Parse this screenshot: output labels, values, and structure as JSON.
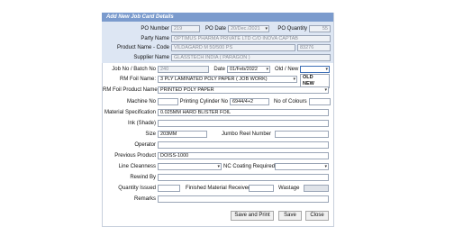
{
  "window": {
    "title": "Add New Job Card Details"
  },
  "header": {
    "po_number": {
      "label": "PO Number",
      "value": "219"
    },
    "po_date": {
      "label": "PO Date",
      "value": "20/Dec./2021"
    },
    "po_quantity": {
      "label": "PO Quantity",
      "value": "55"
    },
    "party_name": {
      "label": "Party Name",
      "value": "OPTIMUS PHARMA PRIVATE LTD C/O INOVA CAPTAB"
    },
    "product_name_code": {
      "label": "Product Name - Code",
      "value": "VILDAGARD M 50/500 PS",
      "code": "83276"
    },
    "supplier_name": {
      "label": "Supplier Name",
      "value": "GLASSTECH INDIA ( PARAGON )"
    }
  },
  "form": {
    "job_batch_no": {
      "label": "Job No / Batch No",
      "value": "240"
    },
    "date": {
      "label": "Date",
      "value": "01/Feb/2022"
    },
    "old_new": {
      "label": "Old / New",
      "value": "",
      "options": [
        "OLD",
        "NEW"
      ]
    },
    "rm_foil_name": {
      "label": "RM Foil Name:",
      "value": "3 PLY LAMINATED POLY PAPER ( JOB WORK)"
    },
    "rm_foil_product_name": {
      "label": "RM Foil Product Name:",
      "value": "PRINTED POLY PAPER"
    },
    "machine_no": {
      "label": "Machine No",
      "value": ""
    },
    "printing_cylinder_no": {
      "label": "Printing Cylinder No",
      "value": "6944/4+2"
    },
    "no_of_colours": {
      "label": "No of Colours",
      "value": ""
    },
    "material_specification": {
      "label": "Material Specification",
      "value": "0.025MM HARD BLISTER FOIL"
    },
    "ink_shade": {
      "label": "Ink (Shade)",
      "value": ""
    },
    "size": {
      "label": "Size",
      "value": "203MM"
    },
    "jumbo_reel_number": {
      "label": "Jumbo Reel Number",
      "value": ""
    },
    "operator": {
      "label": "Operator",
      "value": ""
    },
    "previous_product": {
      "label": "Previous Product",
      "value": "DOISS-1000"
    },
    "line_cleanness": {
      "label": "Line Cleanness",
      "value": ""
    },
    "nc_coating_required": {
      "label": "NC Coating Required",
      "value": ""
    },
    "rewind_by": {
      "label": "Rewind By",
      "value": ""
    },
    "quantity_issued": {
      "label": "Quantity Issued",
      "value": ""
    },
    "finished_material_received": {
      "label": "Finished Material Received",
      "value": ""
    },
    "wastage": {
      "label": "Wastage",
      "value": ""
    },
    "remarks": {
      "label": "Remarks",
      "value": ""
    }
  },
  "buttons": {
    "save_and_print": "Save and Print",
    "save": "Save",
    "close": "Close"
  },
  "icons": {
    "dropdown": "chevron-down-icon",
    "calendar_dropdown": "chevron-down-icon"
  },
  "colors": {
    "title_bar": "#7b9bcd",
    "header_band": "#dde6f3"
  }
}
